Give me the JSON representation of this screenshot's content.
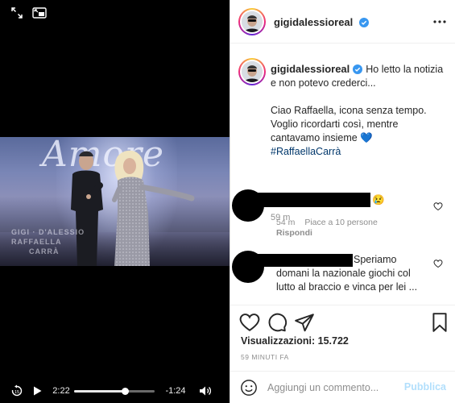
{
  "video": {
    "overlay_word": "Amore",
    "watermark_lines": [
      "GIGI · D'ALESSIO",
      "RAFFAELLA",
      "CARRÀ"
    ],
    "current_time": "2:22",
    "remaining_time": "-1:24",
    "progress_fraction": 0.63,
    "icons": [
      "expand-icon",
      "picture-in-picture-icon",
      "rewind-15-icon",
      "play-icon",
      "volume-icon"
    ]
  },
  "post": {
    "username": "gigidalessioreal",
    "caption": {
      "username": "gigidalessioreal",
      "text": "Ho letto la notizia e non potevo crederci...\n\nCiao Raffaella, icona senza tempo. Voglio ricordarti così, mentre cantavamo insieme 💙",
      "hashtag": "#RaffaellaCarrà",
      "age": "59 m"
    },
    "comments": [
      {
        "text": "😢",
        "age": "54 m",
        "likes": "Piace a 10 persone",
        "reply_label": "Rispondi"
      },
      {
        "text": "Speriamo domani la nazionale giochi col lutto al braccio e vinca per lei ..."
      }
    ],
    "views_label": "Visualizzazioni: 15.722",
    "posted_ago": "59 MINUTI FA",
    "add_comment": {
      "placeholder": "Aggiungi un commento...",
      "publish_label": "Pubblica"
    },
    "colors": {
      "link": "#00376b",
      "verified": "#3897f0",
      "publish_disabled": "#b2dffc",
      "muted": "#8e8e8e"
    }
  }
}
